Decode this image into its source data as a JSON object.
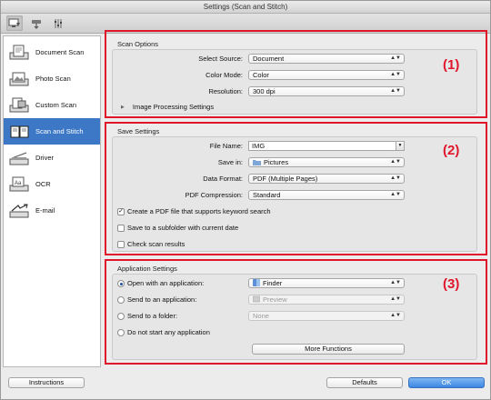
{
  "window": {
    "title": "Settings (Scan and Stitch)"
  },
  "toolbar": {
    "tabs": [
      {
        "icon": "scan-from-computer-icon",
        "selected": true
      },
      {
        "icon": "scan-from-operation-panel-icon",
        "selected": false
      },
      {
        "icon": "general-settings-icon",
        "selected": false
      }
    ]
  },
  "sidebar": {
    "items": [
      {
        "label": "Document Scan",
        "icon": "document-scan-icon",
        "selected": false
      },
      {
        "label": "Photo Scan",
        "icon": "photo-scan-icon",
        "selected": false
      },
      {
        "label": "Custom Scan",
        "icon": "custom-scan-icon",
        "selected": false
      },
      {
        "label": "Scan and Stitch",
        "icon": "scan-and-stitch-icon",
        "selected": true
      },
      {
        "label": "Driver",
        "icon": "driver-icon",
        "selected": false
      },
      {
        "label": "OCR",
        "icon": "ocr-icon",
        "selected": false
      },
      {
        "label": "E-mail",
        "icon": "email-icon",
        "selected": false
      }
    ]
  },
  "scan_options": {
    "title": "Scan Options",
    "number": "(1)",
    "select_source_label": "Select Source:",
    "select_source_value": "Document",
    "color_mode_label": "Color Mode:",
    "color_mode_value": "Color",
    "resolution_label": "Resolution:",
    "resolution_value": "300 dpi",
    "image_processing_label": "Image Processing Settings"
  },
  "save_settings": {
    "title": "Save Settings",
    "number": "(2)",
    "file_name_label": "File Name:",
    "file_name_value": "IMG",
    "save_in_label": "Save in:",
    "save_in_value": "Pictures",
    "data_format_label": "Data Format:",
    "data_format_value": "PDF (Multiple Pages)",
    "pdf_compression_label": "PDF Compression:",
    "pdf_compression_value": "Standard",
    "keyword_search_label": "Create a PDF file that supports keyword search",
    "keyword_search_checked": true,
    "subfolder_label": "Save to a subfolder with current date",
    "subfolder_checked": false,
    "check_results_label": "Check scan results",
    "check_results_checked": false
  },
  "application_settings": {
    "title": "Application Settings",
    "number": "(3)",
    "open_app_label": "Open with an application:",
    "open_app_value": "Finder",
    "send_app_label": "Send to an application:",
    "send_app_value": "Preview",
    "send_folder_label": "Send to a folder:",
    "send_folder_value": "None",
    "no_app_label": "Do not start any application",
    "selected_option": "open_app",
    "more_functions_label": "More Functions"
  },
  "footer": {
    "instructions_label": "Instructions",
    "defaults_label": "Defaults",
    "ok_label": "OK"
  },
  "colors": {
    "highlight_red": "#e0162b",
    "selection_blue": "#3d78c6",
    "ok_blue": "#3b86e3"
  }
}
